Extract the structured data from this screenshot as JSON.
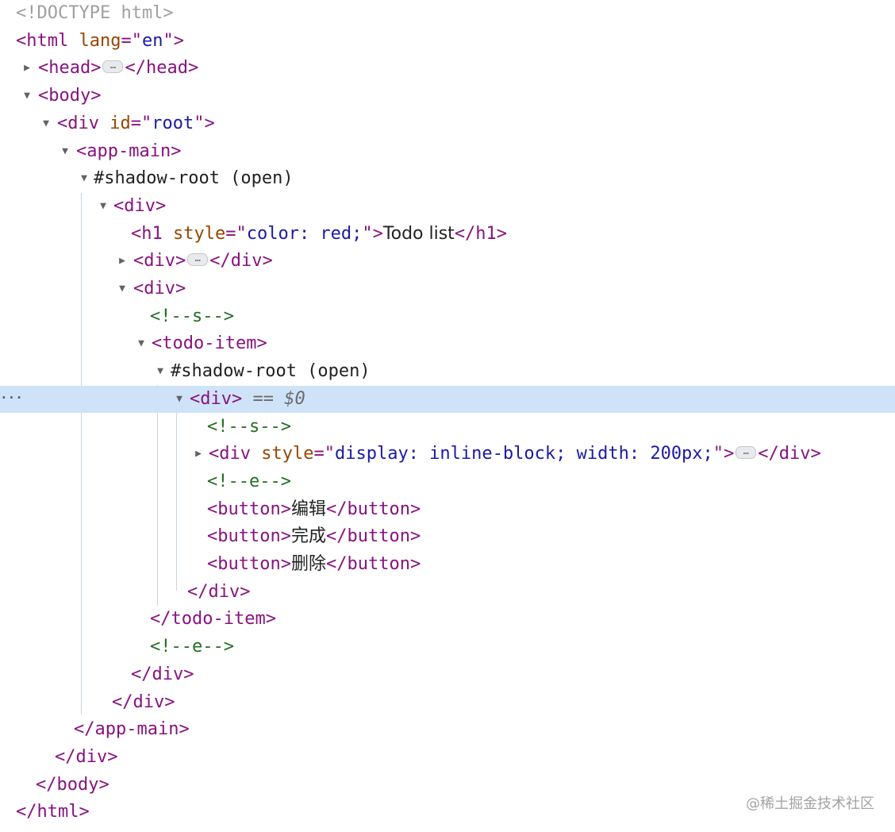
{
  "rows": [
    {
      "parts": [
        {
          "c": "doctype",
          "t": "<!DOCTYPE html>"
        }
      ]
    },
    {
      "parts": [
        {
          "c": "tag",
          "t": "<html "
        },
        {
          "c": "attr-name",
          "t": "lang"
        },
        {
          "c": "tag",
          "t": "=\""
        },
        {
          "c": "attr-value",
          "t": "en"
        },
        {
          "c": "tag",
          "t": "\">"
        }
      ]
    },
    {
      "arrow": "collapsed",
      "parts": [
        {
          "c": "tag",
          "t": "<head>"
        },
        {
          "c": "ellipsis",
          "t": "…"
        },
        {
          "c": "tag",
          "t": "</head>"
        }
      ]
    },
    {
      "arrow": "expanded",
      "parts": [
        {
          "c": "tag",
          "t": "<body>"
        }
      ]
    },
    {
      "arrow": "expanded",
      "parts": [
        {
          "c": "tag",
          "t": "<div "
        },
        {
          "c": "attr-name",
          "t": "id"
        },
        {
          "c": "tag",
          "t": "=\""
        },
        {
          "c": "attr-value",
          "t": "root"
        },
        {
          "c": "tag",
          "t": "\">"
        }
      ]
    },
    {
      "arrow": "expanded",
      "parts": [
        {
          "c": "tag",
          "t": "<app-main>"
        }
      ]
    },
    {
      "arrow": "expanded",
      "parts": [
        {
          "c": "shadow",
          "t": "#shadow-root (open)"
        }
      ]
    },
    {
      "arrow": "expanded",
      "parts": [
        {
          "c": "tag",
          "t": "<div>"
        }
      ]
    },
    {
      "parts": [
        {
          "c": "tag",
          "t": "<h1 "
        },
        {
          "c": "attr-name",
          "t": "style"
        },
        {
          "c": "tag",
          "t": "=\""
        },
        {
          "c": "attr-value",
          "t": "color: red;"
        },
        {
          "c": "tag",
          "t": "\">"
        },
        {
          "c": "text",
          "t": "Todo list"
        },
        {
          "c": "tag",
          "t": "</h1>"
        }
      ]
    },
    {
      "arrow": "collapsed",
      "parts": [
        {
          "c": "tag",
          "t": "<div>"
        },
        {
          "c": "ellipsis",
          "t": "…"
        },
        {
          "c": "tag",
          "t": "</div>"
        }
      ]
    },
    {
      "arrow": "expanded",
      "parts": [
        {
          "c": "tag",
          "t": "<div>"
        }
      ]
    },
    {
      "parts": [
        {
          "c": "comment",
          "t": "<!--s-->"
        }
      ]
    },
    {
      "arrow": "expanded",
      "parts": [
        {
          "c": "tag",
          "t": "<todo-item>"
        }
      ]
    },
    {
      "arrow": "expanded",
      "parts": [
        {
          "c": "shadow",
          "t": "#shadow-root (open)"
        }
      ]
    },
    {
      "arrow": "expanded",
      "selected": true,
      "parts": [
        {
          "c": "tag",
          "t": "<div>"
        },
        {
          "c": "ref",
          "t": " == $0"
        }
      ]
    },
    {
      "parts": [
        {
          "c": "comment",
          "t": "<!--s-->"
        }
      ]
    },
    {
      "arrow": "collapsed",
      "parts": [
        {
          "c": "tag",
          "t": "<div "
        },
        {
          "c": "attr-name",
          "t": "style"
        },
        {
          "c": "tag",
          "t": "=\""
        },
        {
          "c": "attr-value",
          "t": "display: inline-block; width: 200px;"
        },
        {
          "c": "tag",
          "t": "\">"
        },
        {
          "c": "ellipsis",
          "t": "…"
        },
        {
          "c": "tag",
          "t": "</div>"
        }
      ]
    },
    {
      "parts": [
        {
          "c": "comment",
          "t": "<!--e-->"
        }
      ]
    },
    {
      "parts": [
        {
          "c": "tag",
          "t": "<button>"
        },
        {
          "c": "text",
          "t": "编辑"
        },
        {
          "c": "tag",
          "t": "</button>"
        }
      ]
    },
    {
      "parts": [
        {
          "c": "tag",
          "t": "<button>"
        },
        {
          "c": "text",
          "t": "完成"
        },
        {
          "c": "tag",
          "t": "</button>"
        }
      ]
    },
    {
      "parts": [
        {
          "c": "tag",
          "t": "<button>"
        },
        {
          "c": "text",
          "t": "删除"
        },
        {
          "c": "tag",
          "t": "</button>"
        }
      ]
    },
    {
      "parts": [
        {
          "c": "tag",
          "t": "</div>"
        }
      ]
    },
    {
      "parts": [
        {
          "c": "tag",
          "t": "</todo-item>"
        }
      ]
    },
    {
      "parts": [
        {
          "c": "comment",
          "t": "<!--e-->"
        }
      ]
    },
    {
      "parts": [
        {
          "c": "tag",
          "t": "</div>"
        }
      ]
    },
    {
      "parts": [
        {
          "c": "tag",
          "t": "</div>"
        }
      ]
    },
    {
      "parts": [
        {
          "c": "tag",
          "t": "</app-main>"
        }
      ]
    },
    {
      "parts": [
        {
          "c": "tag",
          "t": "</div>"
        }
      ]
    },
    {
      "parts": [
        {
          "c": "tag",
          "t": "</body>"
        }
      ]
    },
    {
      "parts": [
        {
          "c": "tag",
          "t": "</html>"
        }
      ]
    }
  ],
  "selected_row_menu": "···",
  "watermark": "@稀土掘金技术社区",
  "colors": {
    "tag": "#881280",
    "attr_name": "#994500",
    "attr_value": "#1a1aa6",
    "comment": "#236e25",
    "selection": "#cfe3f8"
  }
}
